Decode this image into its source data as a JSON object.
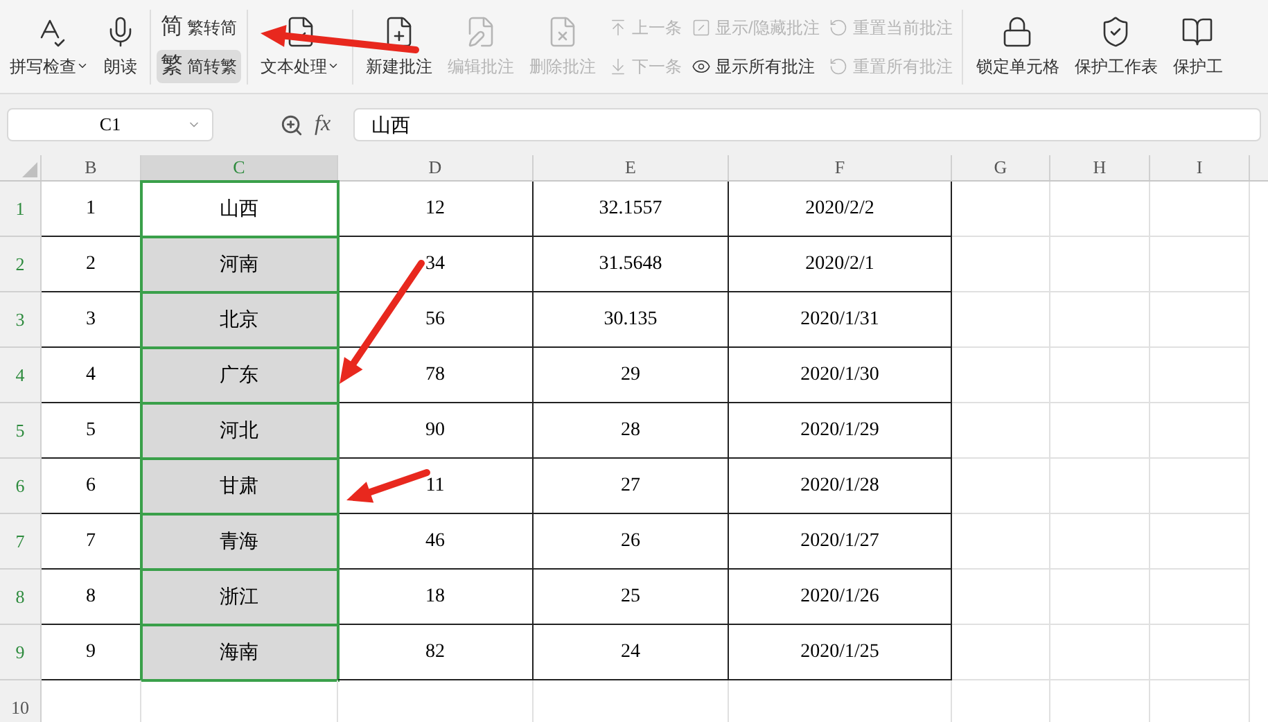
{
  "toolbar": [
    {
      "kind": "big",
      "label": "拼写检查",
      "dropdown": true,
      "disabled": false
    },
    {
      "kind": "big",
      "label": "朗读",
      "dropdown": false,
      "disabled": false
    },
    {
      "kind": "separator"
    },
    {
      "kind": "pair",
      "items": [
        {
          "glyph": "简",
          "label": "繁转简",
          "selected": false,
          "disabled": false
        },
        {
          "glyph": "繁",
          "label": "简转繁",
          "selected": true,
          "disabled": false
        }
      ]
    },
    {
      "kind": "separator"
    },
    {
      "kind": "big",
      "label": "文本处理",
      "dropdown": true,
      "disabled": false
    },
    {
      "kind": "separator"
    },
    {
      "kind": "big",
      "label": "新建批注",
      "dropdown": false,
      "disabled": false
    },
    {
      "kind": "big",
      "label": "编辑批注",
      "dropdown": false,
      "disabled": true
    },
    {
      "kind": "big",
      "label": "删除批注",
      "dropdown": false,
      "disabled": true
    },
    {
      "kind": "pair",
      "items": [
        {
          "label": "上一条",
          "selected": false,
          "disabled": true
        },
        {
          "label": "下一条",
          "selected": false,
          "disabled": true
        }
      ]
    },
    {
      "kind": "pair",
      "items": [
        {
          "label": "显示/隐藏批注",
          "selected": false,
          "disabled": true
        },
        {
          "label": "显示所有批注",
          "selected": false,
          "disabled": false
        }
      ]
    },
    {
      "kind": "pair",
      "items": [
        {
          "label": "重置当前批注",
          "selected": false,
          "disabled": true
        },
        {
          "label": "重置所有批注",
          "selected": false,
          "disabled": true
        }
      ]
    },
    {
      "kind": "separator"
    },
    {
      "kind": "big",
      "label": "锁定单元格",
      "dropdown": false,
      "disabled": false
    },
    {
      "kind": "big",
      "label": "保护工作表",
      "dropdown": false,
      "disabled": false
    },
    {
      "kind": "big",
      "label": "保护工",
      "dropdown": false,
      "disabled": false
    }
  ],
  "formula_bar": {
    "cell_ref": "C1",
    "fx": "fx",
    "value": "山西"
  },
  "columns": [
    {
      "label": "B",
      "selected": false
    },
    {
      "label": "C",
      "selected": true
    },
    {
      "label": "D",
      "selected": false
    },
    {
      "label": "E",
      "selected": false
    },
    {
      "label": "F",
      "selected": false
    },
    {
      "label": "G",
      "selected": false
    },
    {
      "label": "H",
      "selected": false
    },
    {
      "label": "I",
      "selected": false
    }
  ],
  "rows": [
    {
      "number": "1",
      "selected": true,
      "cells": [
        "1",
        "山西",
        "12",
        "32.1557",
        "2020/2/2"
      ]
    },
    {
      "number": "2",
      "selected": true,
      "cells": [
        "2",
        "河南",
        "34",
        "31.5648",
        "2020/2/1"
      ]
    },
    {
      "number": "3",
      "selected": true,
      "cells": [
        "3",
        "北京",
        "56",
        "30.135",
        "2020/1/31"
      ]
    },
    {
      "number": "4",
      "selected": true,
      "cells": [
        "4",
        "广东",
        "78",
        "29",
        "2020/1/30"
      ]
    },
    {
      "number": "5",
      "selected": true,
      "cells": [
        "5",
        "河北",
        "90",
        "28",
        "2020/1/29"
      ]
    },
    {
      "number": "6",
      "selected": true,
      "cells": [
        "6",
        "甘肃",
        "11",
        "27",
        "2020/1/28"
      ]
    },
    {
      "number": "7",
      "selected": true,
      "cells": [
        "7",
        "青海",
        "46",
        "26",
        "2020/1/27"
      ]
    },
    {
      "number": "8",
      "selected": true,
      "cells": [
        "8",
        "浙江",
        "18",
        "25",
        "2020/1/26"
      ]
    },
    {
      "number": "9",
      "selected": true,
      "cells": [
        "9",
        "海南",
        "82",
        "24",
        "2020/1/25"
      ]
    },
    {
      "number": "10",
      "selected": false,
      "cells": []
    }
  ]
}
